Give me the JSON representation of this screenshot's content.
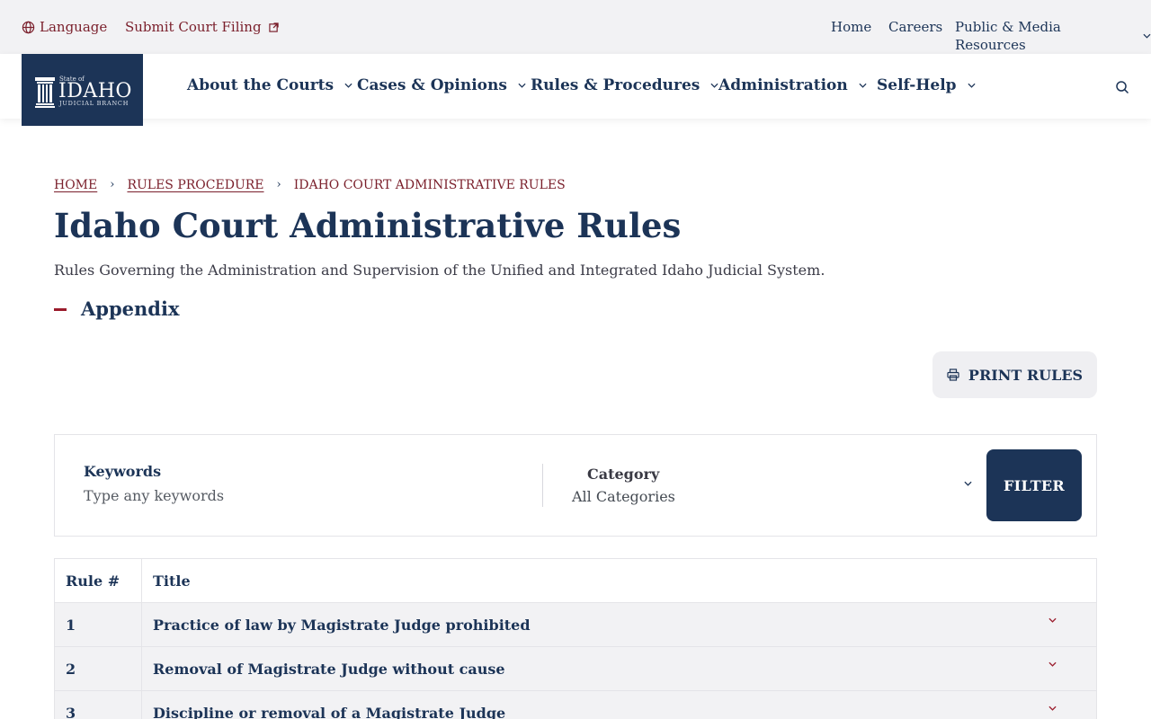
{
  "utility": {
    "language": "Language",
    "submit_filing": "Submit Court Filing",
    "home": "Home",
    "careers": "Careers",
    "public_media": "Public & Media Resources"
  },
  "logo": {
    "state_of": "State of",
    "idaho": "IDAHO",
    "branch": "JUDICIAL BRANCH"
  },
  "nav": {
    "about": "About the Courts",
    "cases": "Cases & Opinions",
    "rules": "Rules & Procedures",
    "administration": "Administration",
    "self_help": "Self-Help"
  },
  "breadcrumb": {
    "home": "HOME",
    "rules_procedure": "RULES PROCEDURE",
    "current": "IDAHO COURT ADMINISTRATIVE RULES",
    "separator": "›"
  },
  "page": {
    "title": "Idaho Court Administrative Rules",
    "subtitle": "Rules Governing the Administration and Supervision of the Unified and Integrated Idaho Judicial System.",
    "appendix": "Appendix",
    "print_label": "PRINT RULES"
  },
  "filter": {
    "keywords_label": "Keywords",
    "keywords_placeholder": "Type any keywords",
    "keywords_value": "",
    "category_label": "Category",
    "category_value": "All Categories",
    "button_label": "FILTER"
  },
  "table": {
    "headers": {
      "number": "Rule #",
      "title": "Title"
    },
    "rows": [
      {
        "number": "1",
        "title": "Practice of law by Magistrate Judge prohibited"
      },
      {
        "number": "2",
        "title": "Removal of Magistrate Judge without cause"
      },
      {
        "number": "3",
        "title": "Discipline or removal of a Magistrate Judge"
      }
    ]
  },
  "colors": {
    "navy": "#1c3457",
    "maroon": "#7a1f2b",
    "utility_bg": "#f2f2f4",
    "row_bg": "#f2f2f4"
  },
  "icons": {
    "language": "globe-icon",
    "external": "external-link-icon",
    "dropdown": "chevron-down-icon",
    "search": "search-icon",
    "print": "printer-icon",
    "logo": "pillar-icon"
  }
}
